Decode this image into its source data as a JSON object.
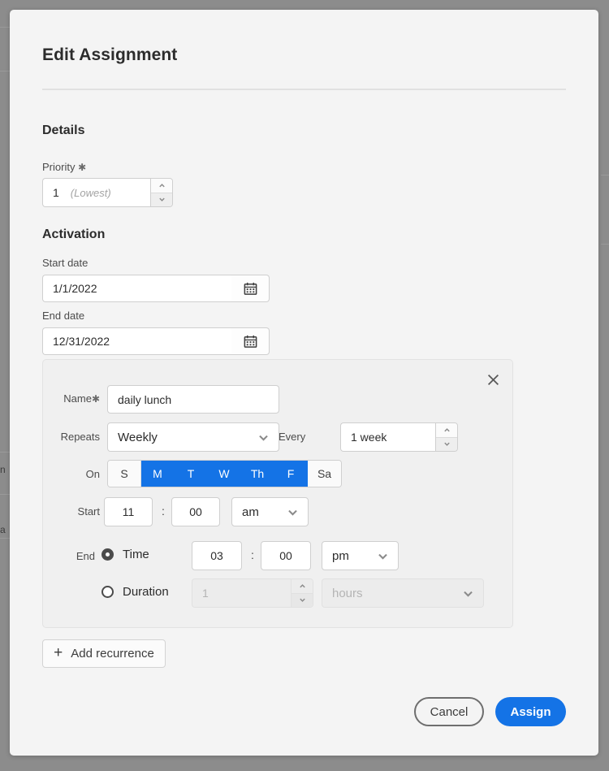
{
  "dialog": {
    "title": "Edit Assignment",
    "sections": {
      "details": {
        "heading": "Details",
        "priority_label": "Priority",
        "priority_required": "✱",
        "priority_value": "1",
        "priority_hint": "(Lowest)"
      },
      "activation": {
        "heading": "Activation",
        "start_date_label": "Start date",
        "start_date_value": "1/1/2022",
        "end_date_label": "End date",
        "end_date_value": "12/31/2022"
      }
    },
    "recurrence": {
      "close_label": "✕",
      "name_label": "Name",
      "name_required": "✱",
      "name_value": "daily lunch",
      "repeats_label": "Repeats",
      "repeats_value": "Weekly",
      "every_label": "Every",
      "every_value": "1 week",
      "on_label": "On",
      "days": [
        {
          "label": "S",
          "selected": false
        },
        {
          "label": "M",
          "selected": true
        },
        {
          "label": "T",
          "selected": true
        },
        {
          "label": "W",
          "selected": true
        },
        {
          "label": "Th",
          "selected": true
        },
        {
          "label": "F",
          "selected": true
        },
        {
          "label": "Sa",
          "selected": false
        }
      ],
      "start_label": "Start",
      "start_hour": "11",
      "start_minute": "00",
      "start_meridiem": "am",
      "time_separator": ":",
      "end_label": "End",
      "end_mode_time_label": "Time",
      "end_mode_duration_label": "Duration",
      "end_mode_selected": "time",
      "end_hour": "03",
      "end_minute": "00",
      "end_meridiem": "pm",
      "duration_value": "1",
      "duration_unit": "hours"
    },
    "footer": {
      "add_recurrence_label": "Add recurrence",
      "add_icon": "+",
      "cancel_label": "Cancel",
      "assign_label": "Assign"
    },
    "colors": {
      "accent": "#1473e6",
      "dialog_bg": "#f4f4f4",
      "card_bg": "#f0f0f0",
      "scrim": "#8c8c8c"
    }
  },
  "background": {
    "fragments": [
      "n",
      "a"
    ]
  }
}
